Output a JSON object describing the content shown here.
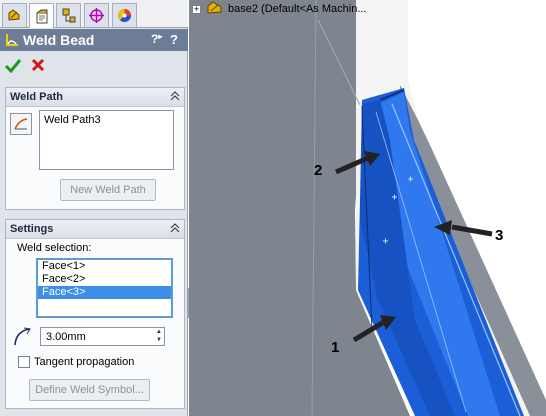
{
  "panel": {
    "title": "Weld Bead",
    "help_glyph": "?",
    "tabs": [
      "property-manager-tab",
      "feature-tab",
      "configuration-tab",
      "dimxpert-tab",
      "display-tab"
    ]
  },
  "weld_path": {
    "title": "Weld Path",
    "items": [
      "Weld Path3"
    ],
    "new_button": "New Weld Path"
  },
  "settings": {
    "title": "Settings",
    "selection_label": "Weld selection:",
    "faces": [
      "Face<1>",
      "Face<2>",
      "Face<3>"
    ],
    "selected_face": "Face<3>",
    "bead_size": "3.00mm",
    "tangent_label": "Tangent propagation",
    "tangent_checked": false,
    "define_symbol_button": "Define Weld Symbol..."
  },
  "tree": {
    "node_text": "base2  (Default<As Machin..."
  },
  "callouts": [
    "1",
    "2",
    "3"
  ],
  "colors": {
    "title_bar": "#6d7d98",
    "selection_blue": "#3d8ee8",
    "face_blue": "#1c5fd8",
    "part_gray": "#7f858e"
  }
}
